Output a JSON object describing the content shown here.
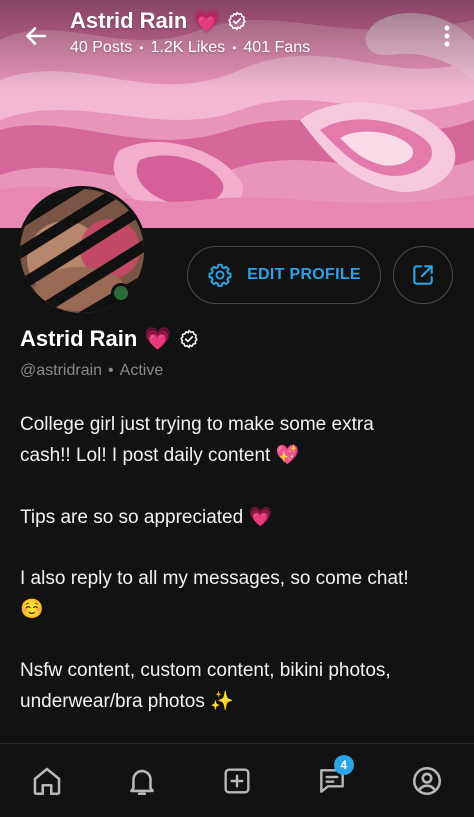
{
  "header": {
    "name": "Astrid Rain",
    "name_emoji": "💗",
    "verified_icon": "verified-check-icon",
    "stats": [
      "40 Posts",
      "1.2K Likes",
      "401 Fans"
    ]
  },
  "actions": {
    "edit_profile_label": "EDIT PROFILE",
    "edit_icon": "gear-icon",
    "share_icon": "share-icon"
  },
  "profile": {
    "name": "Astrid Rain",
    "name_emoji": "💗",
    "handle": "@astridrain",
    "status": "Active"
  },
  "bio": {
    "line1a": "College girl just trying to make some extra",
    "line1b": "cash!! Lol! I post daily content",
    "line1_emoji": "💖",
    "line2": "Tips are so so appreciated",
    "line2_emoji": "💗",
    "line3": "I also reply to all my messages, so come chat!",
    "line3_emoji": "☺️",
    "line4a": "Nsfw content, custom content, bikini photos,",
    "line4b": "underwear/bra photos",
    "line4_emoji": "✨"
  },
  "nav": {
    "items": [
      "home-icon",
      "bell-icon",
      "add-post-icon",
      "messages-icon",
      "profile-icon"
    ],
    "messages_badge": "4"
  },
  "colors": {
    "accent": "#2ba3e6",
    "background": "#121212",
    "cover": "#e58fb4"
  }
}
